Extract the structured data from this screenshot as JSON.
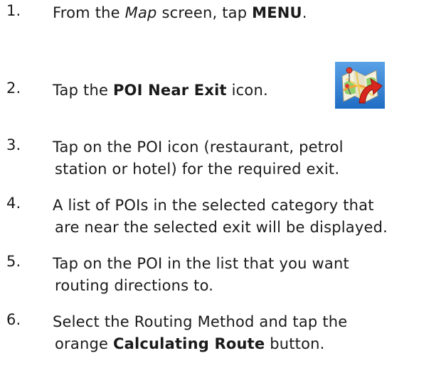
{
  "steps": [
    {
      "number": "1.",
      "lines": [
        {
          "p1": "From the ",
          "em": "Map",
          "p2": " screen, tap ",
          "strong": "MENU",
          "p3": "."
        }
      ]
    },
    {
      "number": "2.",
      "lines": [
        {
          "p1": "Tap the ",
          "strong": "POI Near Exit",
          "p2": " icon."
        }
      ],
      "icon": "poi-near-exit-icon"
    },
    {
      "number": "3.",
      "lines": [
        "Tap on the POI icon (restaurant, petrol",
        "station or hotel) for the required exit."
      ]
    },
    {
      "number": "4.",
      "lines": [
        "A list of POIs in the selected category that",
        "are near the selected exit will be displayed."
      ]
    },
    {
      "number": "5.",
      "lines": [
        "Tap on the POI in the list that you want",
        "routing directions to."
      ]
    },
    {
      "number": "6.",
      "lines": [
        "Select the Routing Method and tap the",
        {
          "p1": "orange ",
          "strong": "Calculating Route",
          "p2": " button."
        }
      ]
    }
  ]
}
